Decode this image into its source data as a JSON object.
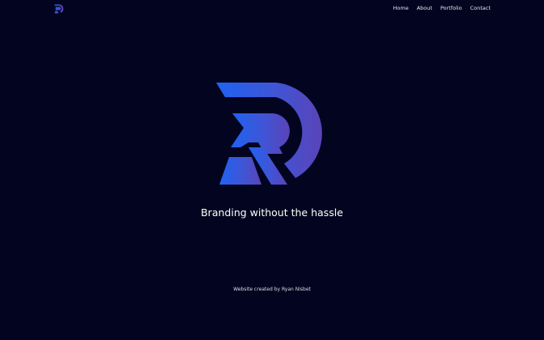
{
  "nav": {
    "logo_icon": "rd-monogram-icon",
    "items": [
      {
        "label": "Home"
      },
      {
        "label": "About"
      },
      {
        "label": "Portfolio"
      },
      {
        "label": "Contact"
      }
    ]
  },
  "hero": {
    "logo_icon": "rd-monogram-icon",
    "tagline": "Branding without the hassle"
  },
  "footer": {
    "credit": "Website created by Ryan Nisbet"
  },
  "colors": {
    "background": "#03041f",
    "gradient_start": "#1f63f2",
    "gradient_end": "#5a43b8",
    "text": "#ffffff"
  }
}
